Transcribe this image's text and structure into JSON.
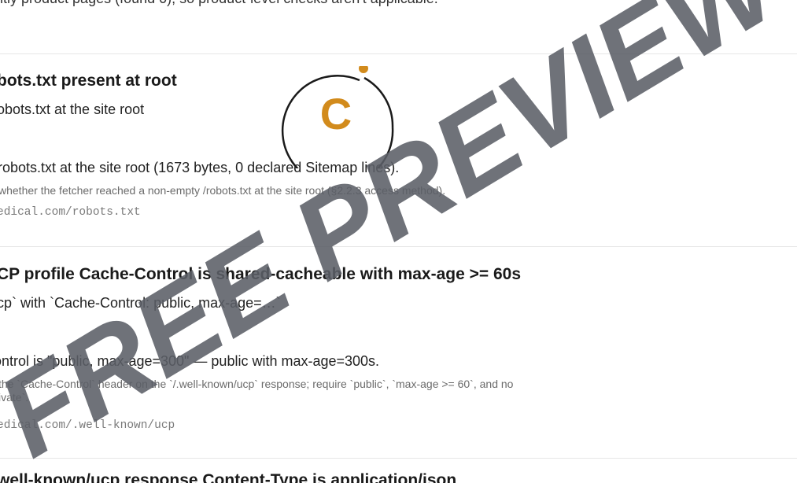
{
  "top_text": "ntly product pages (found 0), so product-level checks aren't applicable.",
  "cards": [
    {
      "title": "bots.txt present at root",
      "description": "obots.txt at the site root",
      "result": "/robots.txt at the site root (1673 bytes, 0 declared Sitemap lines).",
      "method": "whether the fetcher reached a non-empty /robots.txt at the site root (§2.2.3 access method).",
      "method2": "",
      "url": "edical.com/robots.txt"
    },
    {
      "title": "CP profile Cache-Control is shared-cacheable with max-age >= 60s",
      "description": "cp` with `Cache-Control: public, max-age=…`",
      "result": "ontrol is \"public, max-age=300\" — public with max-age=300s.",
      "method": "the `Cache-Control` header on the `/.well-known/ucp` response; require `public`, `max-age >= 60`, and no",
      "method2": "ivate`.",
      "url": "edical.com/.well-known/ucp"
    },
    {
      "title": "well-known/ucp response Content-Type is application/json"
    }
  ],
  "watermark": {
    "text": "FREE PREVIEW",
    "logo_letter": "C",
    "color": "#5b5e66",
    "logo_color": "#d28b1c"
  }
}
